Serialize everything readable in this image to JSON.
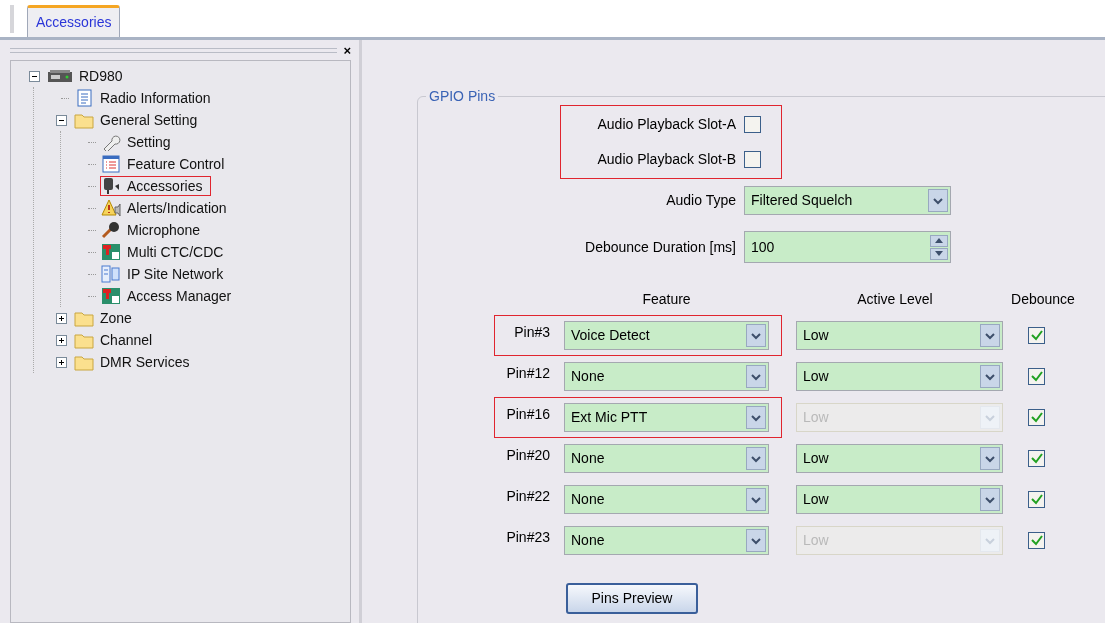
{
  "tabs": [
    {
      "label": "Accessories",
      "selected": true
    }
  ],
  "panel_close": "×",
  "tree": [
    {
      "label": "RD980",
      "kind": "radio",
      "expanded": true,
      "highlighted": false,
      "children": [
        {
          "label": "Radio Information",
          "kind": "document",
          "highlighted": false
        },
        {
          "label": "General Setting",
          "kind": "folder",
          "expanded": true,
          "highlighted": false,
          "children": [
            {
              "label": "Setting",
              "kind": "wrench",
              "highlighted": false
            },
            {
              "label": "Feature Control",
              "kind": "list",
              "highlighted": false
            },
            {
              "label": "Accessories",
              "kind": "handset",
              "highlighted": true
            },
            {
              "label": "Alerts/Indication",
              "kind": "alert",
              "highlighted": false
            },
            {
              "label": "Microphone",
              "kind": "microphone",
              "highlighted": false
            },
            {
              "label": "Multi CTC/CDC",
              "kind": "tile",
              "highlighted": false
            },
            {
              "label": "IP Site Network",
              "kind": "network",
              "highlighted": false
            },
            {
              "label": "Access Manager",
              "kind": "tile",
              "highlighted": false
            }
          ]
        },
        {
          "label": "Zone",
          "kind": "folder",
          "expanded": false,
          "highlighted": false
        },
        {
          "label": "Channel",
          "kind": "folder",
          "expanded": false,
          "highlighted": false
        },
        {
          "label": "DMR Services",
          "kind": "folder",
          "expanded": false,
          "highlighted": false
        }
      ]
    }
  ],
  "gpio": {
    "title": "GPIO Pins",
    "audio_playback": {
      "highlighted": true,
      "items": [
        {
          "label": "Audio Playback Slot-A",
          "checked": false
        },
        {
          "label": "Audio Playback Slot-B",
          "checked": false
        }
      ]
    },
    "audio_type": {
      "label": "Audio Type",
      "value": "Filtered Squelch"
    },
    "debounce_duration": {
      "label": "Debounce Duration [ms]",
      "value": "100"
    },
    "columns": [
      "Feature",
      "Active Level",
      "Debounce"
    ],
    "pins": [
      {
        "label": "Pin#3",
        "feature": "Voice Detect",
        "active_level": "Low",
        "active_level_disabled": false,
        "debounce": true,
        "highlighted": true
      },
      {
        "label": "Pin#12",
        "feature": "None",
        "active_level": "Low",
        "active_level_disabled": false,
        "debounce": true,
        "highlighted": false
      },
      {
        "label": "Pin#16",
        "feature": "Ext Mic PTT",
        "active_level": "Low",
        "active_level_disabled": true,
        "debounce": true,
        "highlighted": true
      },
      {
        "label": "Pin#20",
        "feature": "None",
        "active_level": "Low",
        "active_level_disabled": false,
        "debounce": true,
        "highlighted": false
      },
      {
        "label": "Pin#22",
        "feature": "None",
        "active_level": "Low",
        "active_level_disabled": false,
        "debounce": true,
        "highlighted": false
      },
      {
        "label": "Pin#23",
        "feature": "None",
        "active_level": "Low",
        "active_level_disabled": true,
        "debounce": true,
        "highlighted": false
      }
    ],
    "button": "Pins Preview"
  }
}
